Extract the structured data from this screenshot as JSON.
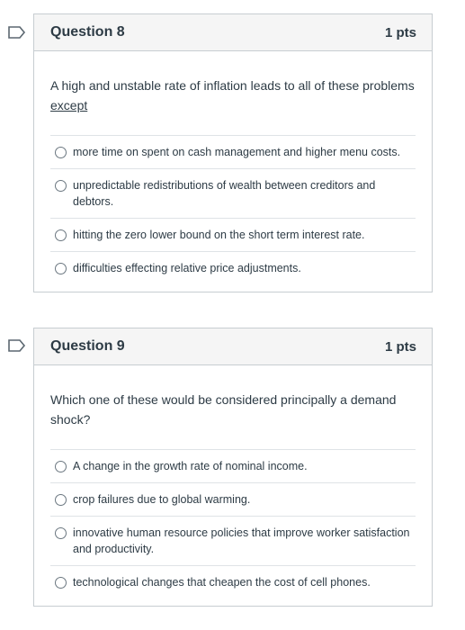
{
  "questions": [
    {
      "title": "Question 8",
      "points": "1 pts",
      "text_before": "A high and unstable rate of inflation leads to all of these problems ",
      "text_emphasis": "except",
      "answers": [
        "more time on spent on cash management and higher menu costs.",
        "unpredictable redistributions of wealth between creditors and debtors.",
        "hitting the zero lower bound on the short term interest rate.",
        "difficulties effecting relative price adjustments."
      ]
    },
    {
      "title": "Question 9",
      "points": "1 pts",
      "text_before": "Which one of these would be considered principally a demand shock?",
      "text_emphasis": "",
      "answers": [
        "A change in the growth rate of nominal income.",
        "crop failures due to global warming.",
        "innovative human resource policies that improve worker satisfaction and productivity.",
        "technological changes that cheapen the cost of cell phones."
      ]
    }
  ],
  "colors": {
    "flag": "#2d3b45",
    "header_bg": "#f5f5f5",
    "border": "#c7cdd1"
  },
  "icons": {
    "flag": "flag-icon",
    "radio": "radio-icon"
  }
}
